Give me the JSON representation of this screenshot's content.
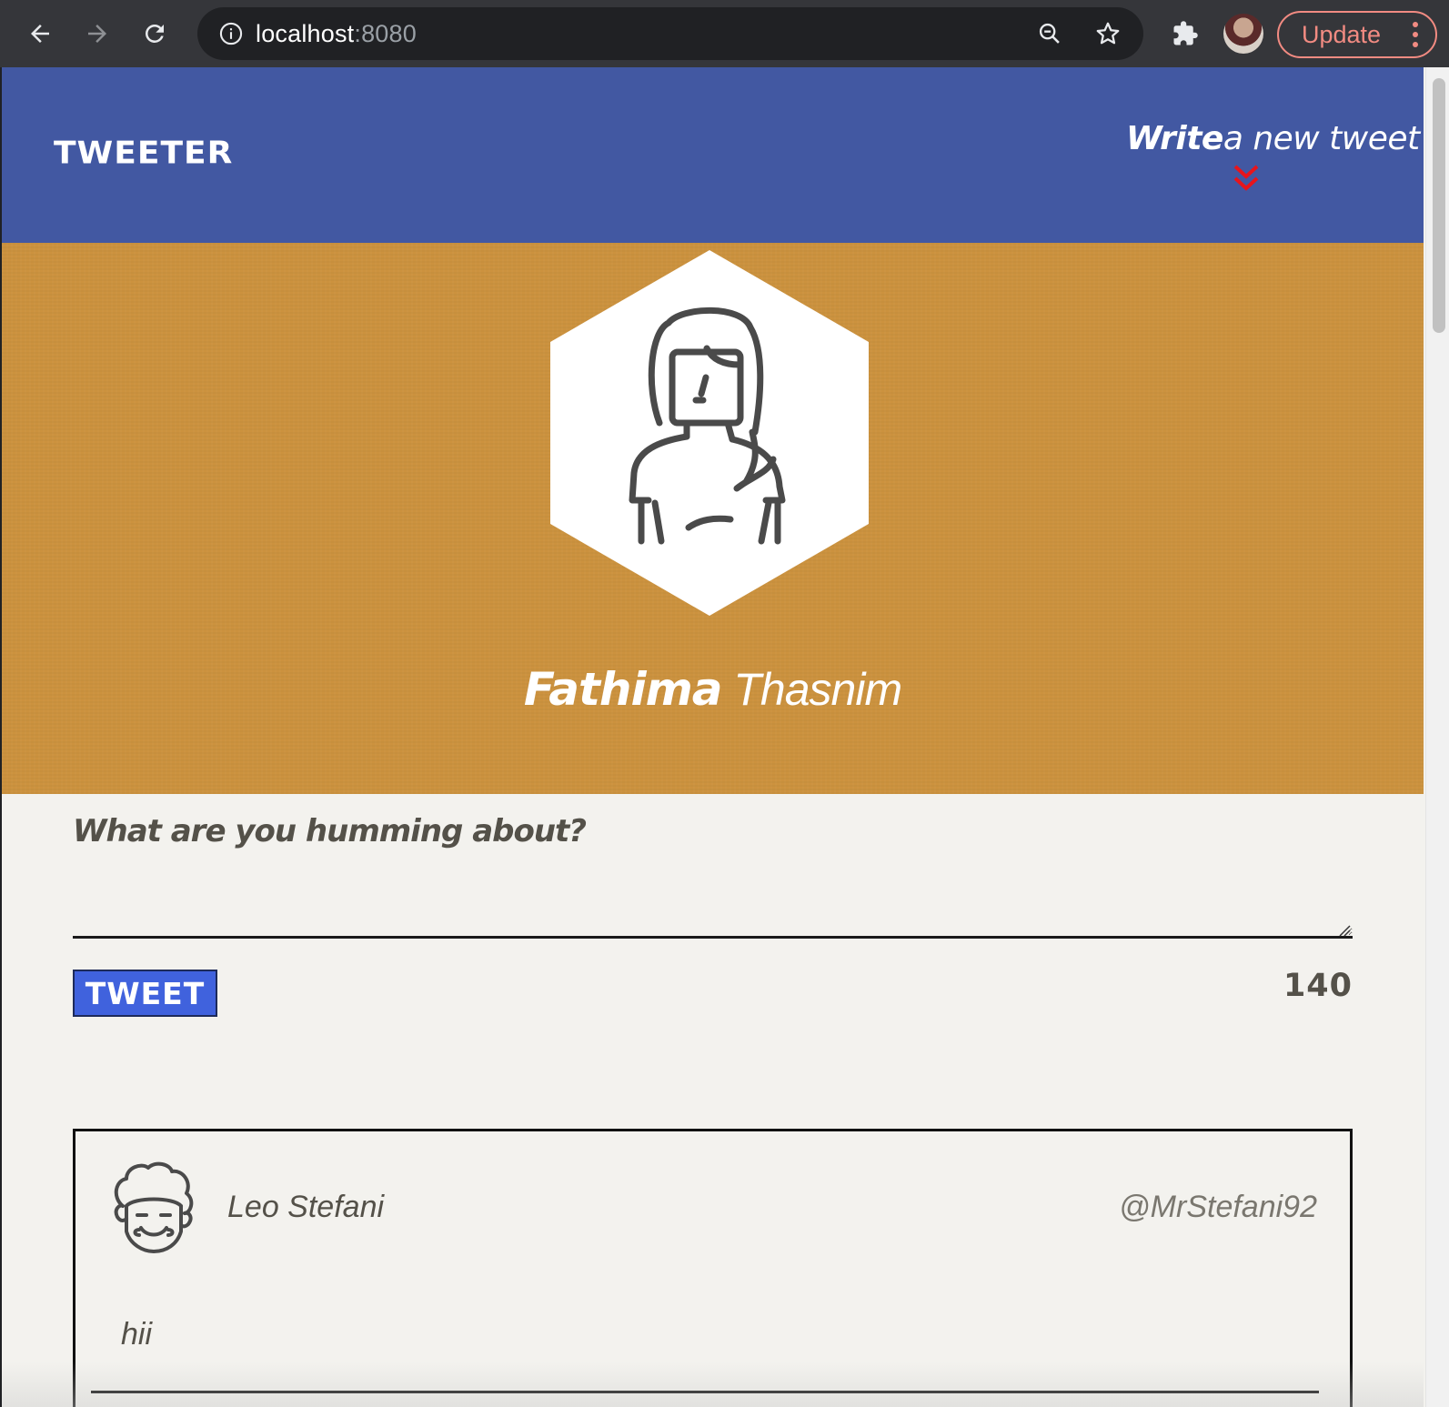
{
  "browser": {
    "url_host": "localhost",
    "url_port": ":8080",
    "update_label": "Update",
    "icons": [
      "back-arrow-icon",
      "forward-arrow-icon",
      "reload-icon",
      "info-icon",
      "zoom-out-icon",
      "bookmark-star-icon",
      "extensions-puzzle-icon",
      "profile-avatar",
      "more-menu-icon"
    ]
  },
  "header": {
    "brand": "TWEETER",
    "compose_bold": "Write",
    "compose_rest": "a new tweet"
  },
  "profile": {
    "first_name": "Fathima",
    "last_name": " Thasnim"
  },
  "composer": {
    "label": "What are you humming about?",
    "value": "",
    "button_label": "TWEET",
    "char_count": "140"
  },
  "tweets": [
    {
      "name": "Leo Stefani",
      "handle": "@MrStefani92",
      "body": "hii"
    }
  ],
  "colors": {
    "nav_bg": "#4258a2",
    "banner_bg": "#cc923e",
    "page_bg": "#f3f2ee",
    "tweet_button": "#4062dd",
    "chevron": "#e8141b"
  }
}
